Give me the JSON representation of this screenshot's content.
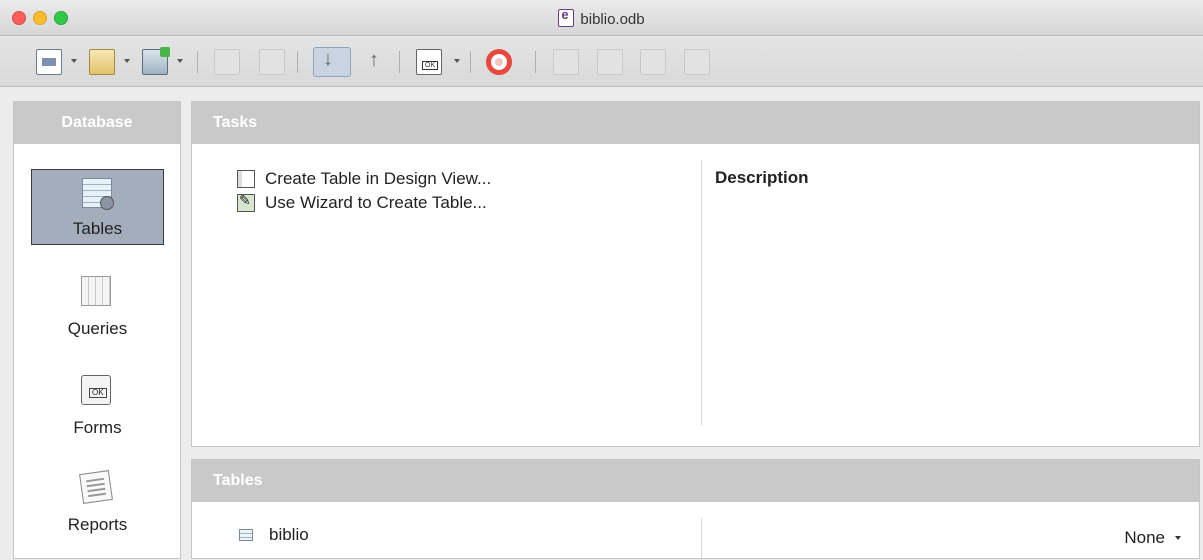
{
  "window": {
    "title": "biblio.odb"
  },
  "toolbar": {
    "items": [
      {
        "name": "new-document",
        "icon": "new-document-icon"
      },
      {
        "name": "open",
        "icon": "folder-open-icon"
      },
      {
        "name": "save",
        "icon": "save-icon"
      },
      {
        "name": "copy",
        "icon": "copy-icon"
      },
      {
        "name": "paste",
        "icon": "paste-icon"
      },
      {
        "name": "sort-ascending",
        "icon": "sort-ascending-icon"
      },
      {
        "name": "sort-descending",
        "icon": "sort-descending-icon"
      },
      {
        "name": "form",
        "icon": "form-icon"
      },
      {
        "name": "help",
        "icon": "lifebuoy-icon"
      },
      {
        "name": "table",
        "icon": "table-icon"
      },
      {
        "name": "edit",
        "icon": "edit-icon"
      },
      {
        "name": "delete",
        "icon": "delete-icon"
      },
      {
        "name": "rename",
        "icon": "rename-icon"
      }
    ]
  },
  "database_panel": {
    "header": "Database",
    "items": [
      {
        "label": "Tables",
        "icon": "tables-icon",
        "selected": true
      },
      {
        "label": "Queries",
        "icon": "queries-icon",
        "selected": false
      },
      {
        "label": "Forms",
        "icon": "forms-icon",
        "selected": false
      },
      {
        "label": "Reports",
        "icon": "reports-icon",
        "selected": false
      }
    ]
  },
  "tasks_panel": {
    "header": "Tasks",
    "tasks": [
      {
        "label": "Create Table in Design View...",
        "icon": "design-view-icon"
      },
      {
        "label": "Use Wizard to Create Table...",
        "icon": "wizard-icon"
      }
    ],
    "description_title": "Description"
  },
  "tables_panel": {
    "header": "Tables",
    "rows": [
      {
        "label": "biblio",
        "icon": "table-icon"
      }
    ],
    "preview_value": "None"
  },
  "colors": {
    "panel_header_bg": "#c9c9c9",
    "selected_item_bg": "#a3adbc"
  }
}
